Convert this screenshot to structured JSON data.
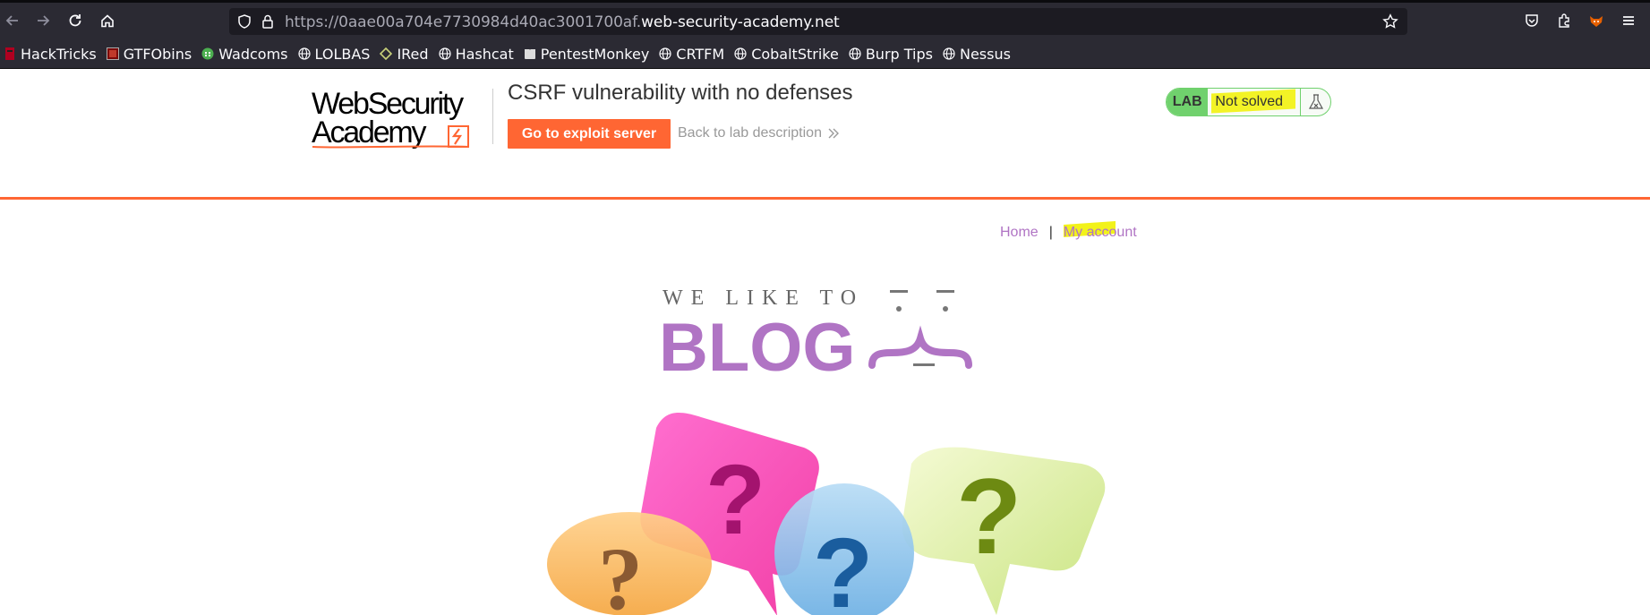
{
  "browser": {
    "url_prefix": "https://0aae00a704e7730984d40ac3001700af.",
    "url_domain": "web-security-academy.net",
    "bookmarks": [
      {
        "label": "HackTricks",
        "icon": "hacktricks-icon"
      },
      {
        "label": "GTFObins",
        "icon": "gtfobins-icon"
      },
      {
        "label": "Wadcoms",
        "icon": "wadcoms-icon"
      },
      {
        "label": "LOLBAS",
        "icon": "globe-icon"
      },
      {
        "label": "IRed",
        "icon": "ired-icon"
      },
      {
        "label": "Hashcat",
        "icon": "globe-icon"
      },
      {
        "label": "PentestMonkey",
        "icon": "book-icon"
      },
      {
        "label": "CRTFM",
        "icon": "globe-icon"
      },
      {
        "label": "CobaltStrike",
        "icon": "globe-icon"
      },
      {
        "label": "Burp Tips",
        "icon": "globe-icon"
      },
      {
        "label": "Nessus",
        "icon": "globe-icon"
      }
    ]
  },
  "lab": {
    "logo_line1": "WebSecurity",
    "logo_line2": "Academy",
    "title": "CSRF vulnerability with no defenses",
    "exploit_button": "Go to exploit server",
    "back_link": "Back to lab description",
    "status_badge": "LAB",
    "status_text": "Not solved"
  },
  "nav": {
    "home": "Home",
    "separator": "|",
    "my_account": "My account"
  },
  "banner": {
    "tagline": "WE LIKE TO",
    "word": "BLOG"
  },
  "colors": {
    "accent_orange": "#ff6633",
    "lab_green": "#70d16d",
    "link_purple": "#b074c4",
    "highlight_yellow": "#f2f21a"
  }
}
